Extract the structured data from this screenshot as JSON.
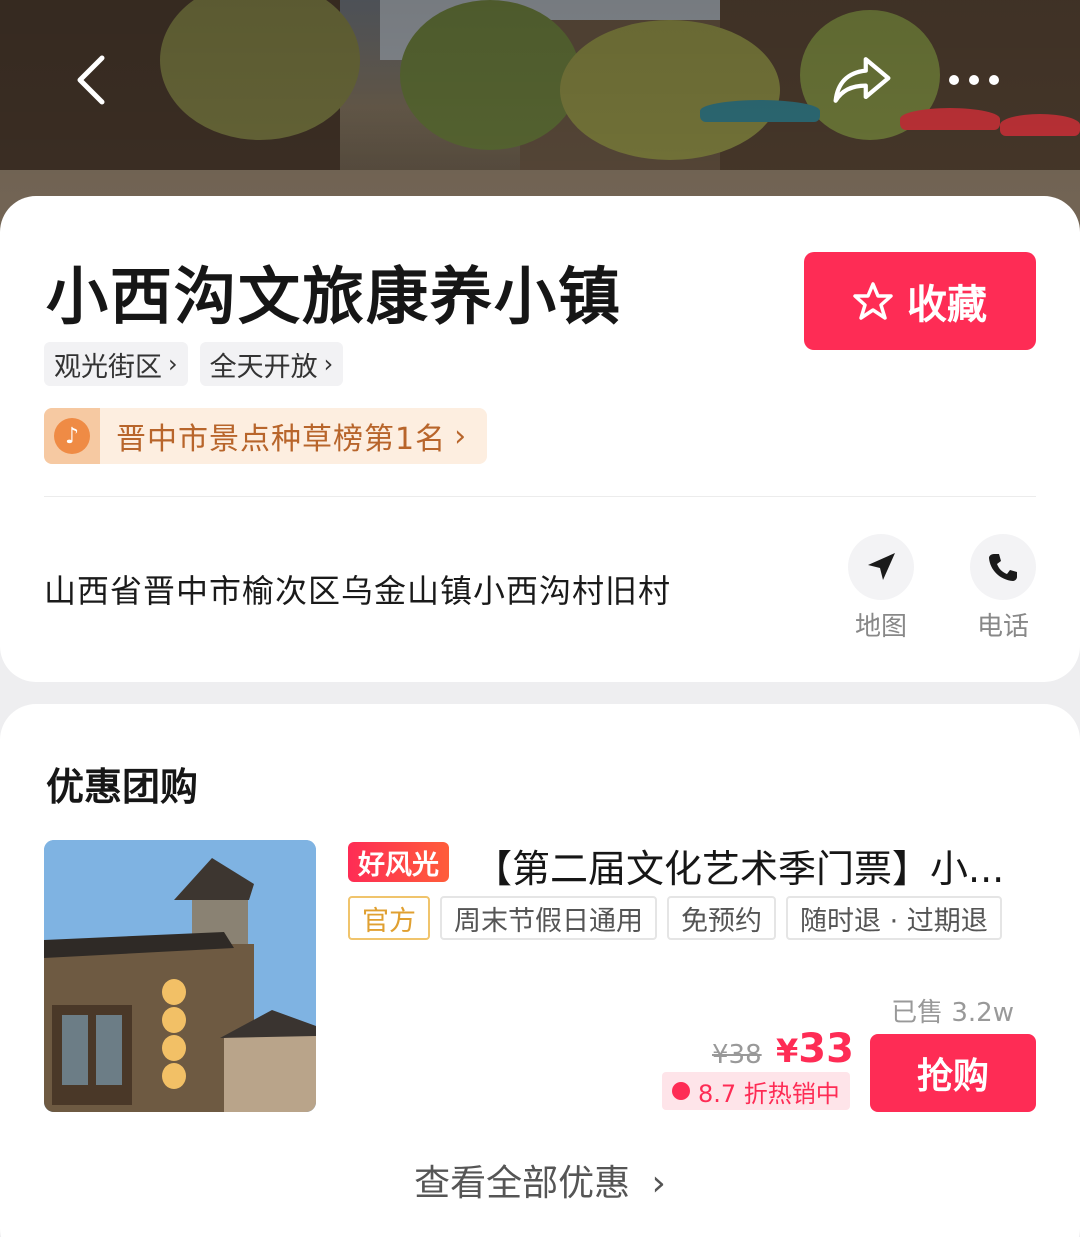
{
  "header": {
    "back_icon": "chevron-left-icon",
    "share_icon": "share-icon",
    "more_icon": "more-dots-icon"
  },
  "info": {
    "title": "小西沟文旅康养小镇",
    "favorite_label": "收藏",
    "tags": [
      {
        "label": "观光街区"
      },
      {
        "label": "全天开放"
      }
    ],
    "rank_text": "晋中市景点种草榜第1名",
    "address": "山西省晋中市榆次区乌金山镇小西沟村旧村",
    "actions": [
      {
        "label": "地图",
        "icon": "navigation-arrow-icon"
      },
      {
        "label": "电话",
        "icon": "phone-icon"
      }
    ]
  },
  "deals": {
    "section_title": "优惠团购",
    "item": {
      "badge": "好风光",
      "title": "【第二届文化艺术季门票】小...",
      "chips": [
        "官方",
        "周末节假日通用",
        "免预约",
        "随时退 · 过期退"
      ],
      "sold": "已售 3.2w",
      "original_price": "¥38",
      "price_symbol": "¥",
      "price_value": "33",
      "discount": "8.7 折热销中",
      "buy_label": "抢购"
    },
    "view_all": "查看全部优惠"
  },
  "colors": {
    "accent": "#fe2c55",
    "rank_bg": "#fdeee0",
    "rank_text": "#b8652b",
    "official_chip": "#e0a031"
  }
}
